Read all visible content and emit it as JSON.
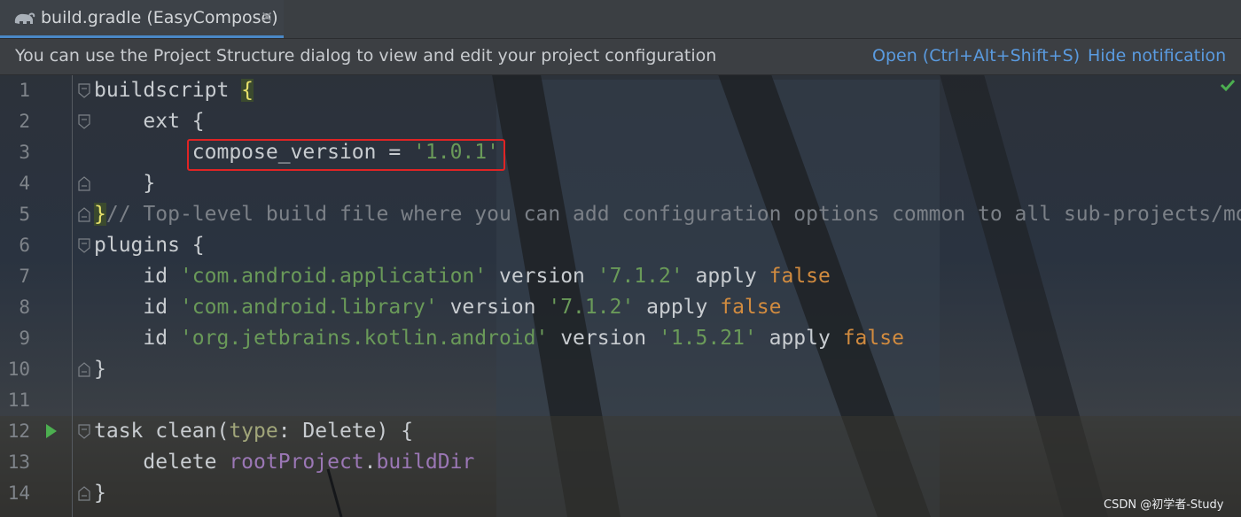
{
  "tab": {
    "title": "build.gradle (EasyCompose)",
    "close_icon": "close-icon",
    "file_icon": "gradle-elephant-icon"
  },
  "notification": {
    "message": "You can use the Project Structure dialog to view and edit your project configuration",
    "open_link": "Open (Ctrl+Alt+Shift+S)",
    "hide_link": "Hide notification"
  },
  "colors": {
    "accent": "#4a88c7",
    "link": "#5a9be0",
    "string": "#6a9a59",
    "keyword": "#d18b3f",
    "highlight_border": "#e02424",
    "check": "#4caf50"
  },
  "editor": {
    "lines": [
      {
        "number": "1",
        "segments": [
          {
            "t": "buildscript ",
            "c": ""
          },
          {
            "t": "{",
            "c": "brace-hl"
          }
        ]
      },
      {
        "number": "2",
        "segments": [
          {
            "t": "    ext {",
            "c": ""
          }
        ]
      },
      {
        "number": "3",
        "segments": [
          {
            "t": "        compose_version = ",
            "c": ""
          },
          {
            "t": "'1.0.1'",
            "c": "str"
          }
        ]
      },
      {
        "number": "4",
        "segments": [
          {
            "t": "    }",
            "c": ""
          }
        ]
      },
      {
        "number": "5",
        "segments": [
          {
            "t": "}",
            "c": "brace-hl"
          },
          {
            "t": "// Top-level build file where you can add configuration options common to all sub-projects/mod",
            "c": "cm"
          }
        ]
      },
      {
        "number": "6",
        "segments": [
          {
            "t": "plugins {",
            "c": ""
          }
        ]
      },
      {
        "number": "7",
        "segments": [
          {
            "t": "    id ",
            "c": ""
          },
          {
            "t": "'com.android.application'",
            "c": "str"
          },
          {
            "t": " version ",
            "c": ""
          },
          {
            "t": "'7.1.2'",
            "c": "str"
          },
          {
            "t": " apply ",
            "c": ""
          },
          {
            "t": "false",
            "c": "kw"
          }
        ]
      },
      {
        "number": "8",
        "segments": [
          {
            "t": "    id ",
            "c": ""
          },
          {
            "t": "'com.android.library'",
            "c": "str"
          },
          {
            "t": " version ",
            "c": ""
          },
          {
            "t": "'7.1.2'",
            "c": "str"
          },
          {
            "t": " apply ",
            "c": ""
          },
          {
            "t": "false",
            "c": "kw"
          }
        ]
      },
      {
        "number": "9",
        "segments": [
          {
            "t": "    id ",
            "c": ""
          },
          {
            "t": "'org.jetbrains.kotlin.android'",
            "c": "str"
          },
          {
            "t": " version ",
            "c": ""
          },
          {
            "t": "'1.5.21'",
            "c": "str"
          },
          {
            "t": " apply ",
            "c": ""
          },
          {
            "t": "false",
            "c": "kw"
          }
        ]
      },
      {
        "number": "10",
        "segments": [
          {
            "t": "}",
            "c": ""
          }
        ]
      },
      {
        "number": "11",
        "segments": []
      },
      {
        "number": "12",
        "segments": [
          {
            "t": "task clean(",
            "c": ""
          },
          {
            "t": "type",
            "c": "param"
          },
          {
            "t": ": Delete) {",
            "c": ""
          }
        ]
      },
      {
        "number": "13",
        "segments": [
          {
            "t": "    delete ",
            "c": ""
          },
          {
            "t": "rootProject",
            "c": "prop"
          },
          {
            "t": ".",
            "c": ""
          },
          {
            "t": "buildDir",
            "c": "prop"
          }
        ]
      },
      {
        "number": "14",
        "segments": [
          {
            "t": "}",
            "c": ""
          }
        ]
      }
    ]
  },
  "watermark": "CSDN @初学者-Study"
}
